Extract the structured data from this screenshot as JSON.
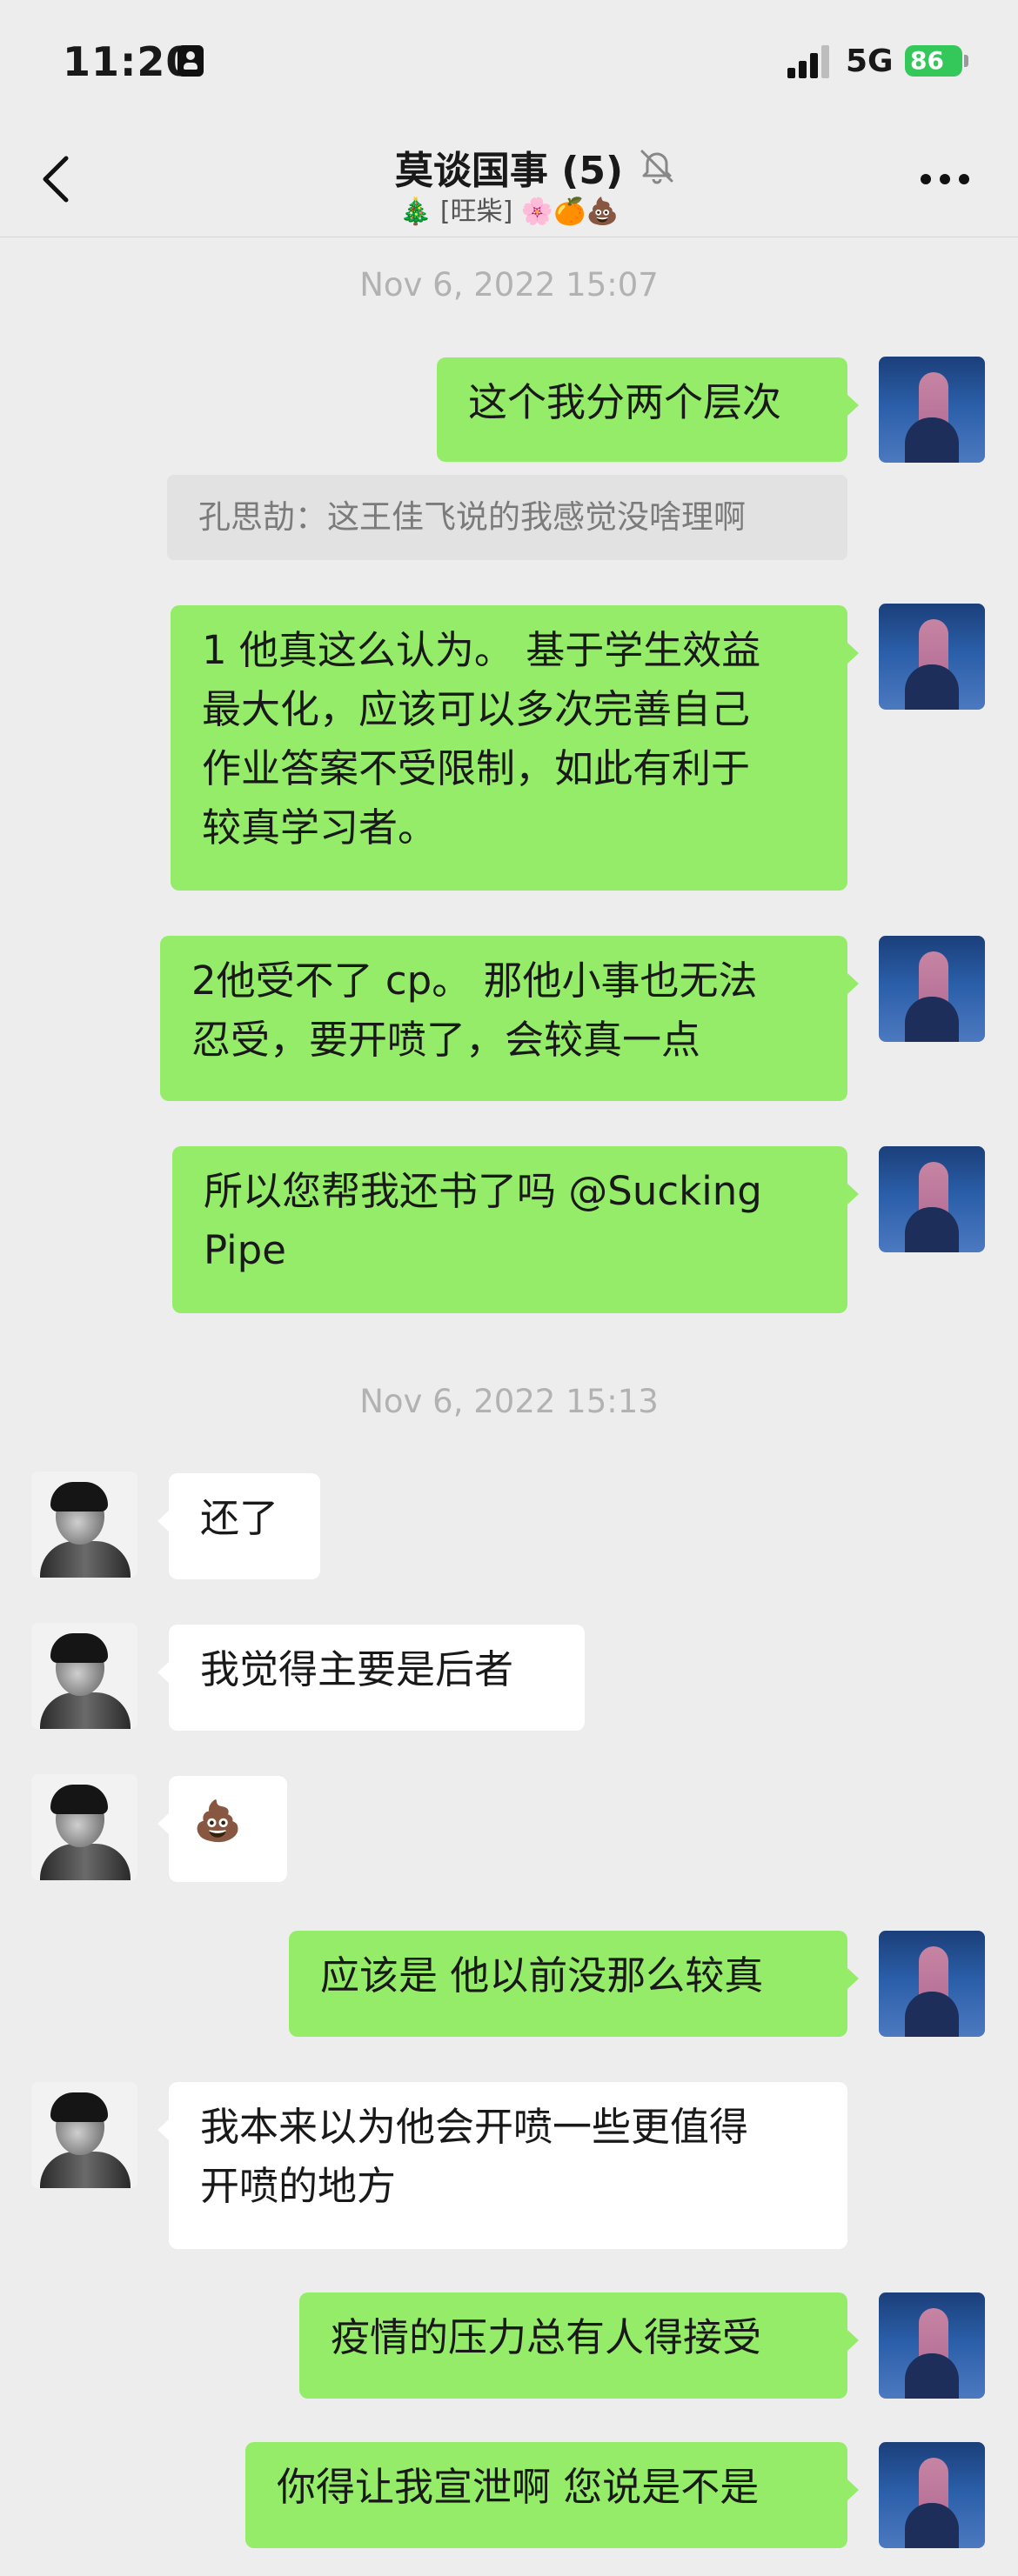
{
  "status_bar": {
    "time": "11:20",
    "network": "5G",
    "battery": "86"
  },
  "header": {
    "title": "莫谈国事 (5)",
    "subtitle": "🎄 [旺柴] 🌸🍊💩"
  },
  "messages": [
    {
      "kind": "timestamp",
      "text": "Nov 6, 2022 15:07"
    },
    {
      "kind": "sent",
      "text": "这个我分两个层次"
    },
    {
      "kind": "quote",
      "text": "孔思劼：这王佳飞说的我感觉没啥理啊"
    },
    {
      "kind": "sent",
      "lines": [
        "1 他真这么认为。 基于学生效益",
        "最大化，应该可以多次完善自己",
        "作业答案不受限制，如此有利于",
        "较真学习者。"
      ]
    },
    {
      "kind": "sent",
      "lines": [
        "2他受不了 cp。 那他小事也无法",
        "忍受，要开喷了，会较真一点"
      ]
    },
    {
      "kind": "sent",
      "lines": [
        "所以您帮我还书了吗 @Sucking",
        "Pipe"
      ]
    },
    {
      "kind": "timestamp",
      "text": "Nov 6, 2022 15:13"
    },
    {
      "kind": "received",
      "text": "还了"
    },
    {
      "kind": "received",
      "text": "我觉得主要是后者"
    },
    {
      "kind": "received",
      "text": "💩"
    },
    {
      "kind": "sent",
      "text": "应该是 他以前没那么较真"
    },
    {
      "kind": "received",
      "lines": [
        "我本来以为他会开喷一些更值得",
        "开喷的地方"
      ]
    },
    {
      "kind": "sent",
      "text": "疫情的压力总有人得接受"
    },
    {
      "kind": "sent",
      "text": "你得让我宣泄啊 您说是不是"
    }
  ]
}
